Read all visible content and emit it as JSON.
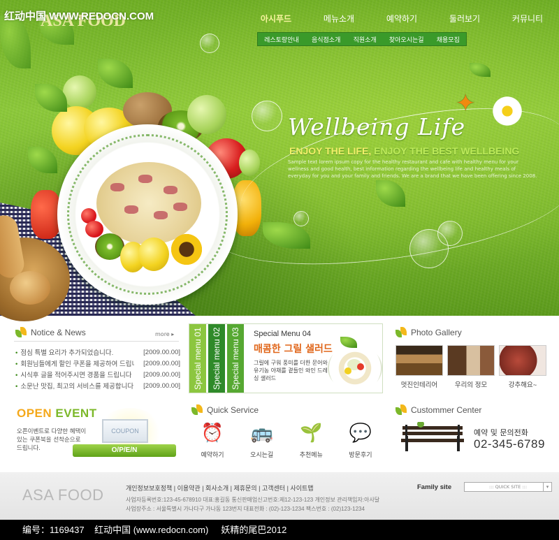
{
  "watermark": "红动中国 WWW.REDOCN.COM",
  "logo_text": "ASA FOOD",
  "nav": [
    {
      "label": "아시푸드"
    },
    {
      "label": "메뉴소개"
    },
    {
      "label": "예약하기"
    },
    {
      "label": "둘러보기"
    },
    {
      "label": "커뮤니티"
    }
  ],
  "subnav": [
    {
      "label": "레스토랑안내"
    },
    {
      "label": "음식점소개"
    },
    {
      "label": "직원소개"
    },
    {
      "label": "찾아오시는길"
    },
    {
      "label": "채용모집"
    }
  ],
  "hero": {
    "title": "Wellbeing Life",
    "tagline_a": "ENJOY THE LIFE,",
    "tagline_b": " ENJOY THE BEST WELLBEING",
    "body": "Sample text lorem ipsum copy for the healthy restaurant and cafe with healthy menu for your wellness and good health, best information regarding the wellbeing life and healthy meals of everyday for you and your family and friends. We are a brand that we have been offering since 2008."
  },
  "notice": {
    "title": "Notice & News",
    "more": "more",
    "items": [
      {
        "title": "점심 특별 요리가 추가되었습니다.",
        "date": "[2009.00.00]"
      },
      {
        "title": "회원님들에게 할인 쿠폰을 제공하여 드립니다",
        "date": "[2009.00.00]"
      },
      {
        "title": "시식후 글을 적어주시면 경품을 드립니다",
        "date": "[2009.00.00]"
      },
      {
        "title": "소문난 맛집, 최고의 서비스를 제공합니다",
        "date": "[2009.00.00]"
      }
    ]
  },
  "special": {
    "tabs": [
      {
        "label": "Special menu 01"
      },
      {
        "label": "Special menu 02"
      },
      {
        "label": "Special menu 03"
      }
    ],
    "tab_colors": [
      "#8cc63f",
      "#2f8a2a",
      "#56a832"
    ],
    "title": "Special Menu 04",
    "name": "매콤한 그릴 샐러드",
    "desc": "그릴에 구워 풍미를 더한 문어와 유기농 야채를 곁들인 와인 드레싱 샐러드"
  },
  "gallery": {
    "title": "Photo Gallery",
    "items": [
      {
        "caption": "멋진인테리어"
      },
      {
        "caption": "우리의 정모"
      },
      {
        "caption": "강추해요~"
      }
    ]
  },
  "open_event": {
    "title_a": "OPEN ",
    "title_b": "EVENT",
    "desc": "오픈이벤트로 다양한 혜택이 있는 쿠폰북을 선착순으로 드립니다.",
    "coupon": "COUPON",
    "ribbon": "O/P/E/N"
  },
  "quick": {
    "title": "Quick Service",
    "items": [
      {
        "label": "예약하기",
        "icon": "alarm-clock-icon",
        "glyph": "⏰"
      },
      {
        "label": "오시는길",
        "icon": "bus-icon",
        "glyph": "🚌"
      },
      {
        "label": "추천메뉴",
        "icon": "sprout-icon",
        "glyph": "🌱"
      },
      {
        "label": "방문후기",
        "icon": "chat-icon",
        "glyph": "💬"
      }
    ]
  },
  "customer": {
    "title": "Custommer Center",
    "label": "예약 및 문의전화",
    "phone": "02-345-6789"
  },
  "footer": {
    "logo": "ASA FOOD",
    "links": "개인정보보호정책  |  이용약관  |  회사소개  |  제휴문의  |  고객센터  |  사이트맵",
    "info1": "사업자등록번호:123-45-678910 대표:홍길동 통신판매업신고번호:제12-123-123 개인정보 관리책임자:아사달",
    "info2": "사업장주소 : 서울특별시 가나다구 가나동 123번지 대표전화 : (02)-123-1234 팩스번호 : (02)123-1234",
    "family_label": "Family site",
    "family_select": "::: QUICK SITE :::"
  },
  "caption_bar": "编号：1169437    红动中国 (www.redocn.com)     妖精的尾巴2012"
}
